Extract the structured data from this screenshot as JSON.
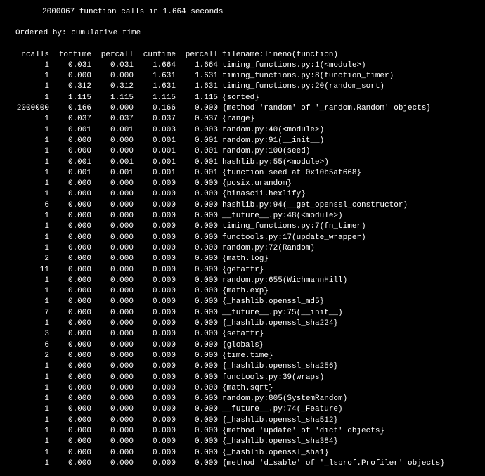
{
  "summary": "2000067 function calls in 1.664 seconds",
  "ordered_by": "Ordered by: cumulative time",
  "headers": {
    "ncalls": "ncalls",
    "tottime": "tottime",
    "percall": "percall",
    "cumtime": "cumtime",
    "percall2": "percall",
    "file": "filename:lineno(function)"
  },
  "rows": [
    {
      "ncalls": "1",
      "tottime": "0.031",
      "percall": "0.031",
      "cumtime": "1.664",
      "percall2": "1.664",
      "file": "timing_functions.py:1(<module>)"
    },
    {
      "ncalls": "1",
      "tottime": "0.000",
      "percall": "0.000",
      "cumtime": "1.631",
      "percall2": "1.631",
      "file": "timing_functions.py:8(function_timer)"
    },
    {
      "ncalls": "1",
      "tottime": "0.312",
      "percall": "0.312",
      "cumtime": "1.631",
      "percall2": "1.631",
      "file": "timing_functions.py:20(random_sort)"
    },
    {
      "ncalls": "1",
      "tottime": "1.115",
      "percall": "1.115",
      "cumtime": "1.115",
      "percall2": "1.115",
      "file": "{sorted}"
    },
    {
      "ncalls": "2000000",
      "tottime": "0.166",
      "percall": "0.000",
      "cumtime": "0.166",
      "percall2": "0.000",
      "file": "{method 'random' of '_random.Random' objects}"
    },
    {
      "ncalls": "1",
      "tottime": "0.037",
      "percall": "0.037",
      "cumtime": "0.037",
      "percall2": "0.037",
      "file": "{range}"
    },
    {
      "ncalls": "1",
      "tottime": "0.001",
      "percall": "0.001",
      "cumtime": "0.003",
      "percall2": "0.003",
      "file": "random.py:40(<module>)"
    },
    {
      "ncalls": "1",
      "tottime": "0.000",
      "percall": "0.000",
      "cumtime": "0.001",
      "percall2": "0.001",
      "file": "random.py:91(__init__)"
    },
    {
      "ncalls": "1",
      "tottime": "0.000",
      "percall": "0.000",
      "cumtime": "0.001",
      "percall2": "0.001",
      "file": "random.py:100(seed)"
    },
    {
      "ncalls": "1",
      "tottime": "0.001",
      "percall": "0.001",
      "cumtime": "0.001",
      "percall2": "0.001",
      "file": "hashlib.py:55(<module>)"
    },
    {
      "ncalls": "1",
      "tottime": "0.001",
      "percall": "0.001",
      "cumtime": "0.001",
      "percall2": "0.001",
      "file": "{function seed at 0x10b5af668}"
    },
    {
      "ncalls": "1",
      "tottime": "0.000",
      "percall": "0.000",
      "cumtime": "0.000",
      "percall2": "0.000",
      "file": "{posix.urandom}"
    },
    {
      "ncalls": "1",
      "tottime": "0.000",
      "percall": "0.000",
      "cumtime": "0.000",
      "percall2": "0.000",
      "file": "{binascii.hexlify}"
    },
    {
      "ncalls": "6",
      "tottime": "0.000",
      "percall": "0.000",
      "cumtime": "0.000",
      "percall2": "0.000",
      "file": "hashlib.py:94(__get_openssl_constructor)"
    },
    {
      "ncalls": "1",
      "tottime": "0.000",
      "percall": "0.000",
      "cumtime": "0.000",
      "percall2": "0.000",
      "file": "__future__.py:48(<module>)"
    },
    {
      "ncalls": "1",
      "tottime": "0.000",
      "percall": "0.000",
      "cumtime": "0.000",
      "percall2": "0.000",
      "file": "timing_functions.py:7(fn_timer)"
    },
    {
      "ncalls": "1",
      "tottime": "0.000",
      "percall": "0.000",
      "cumtime": "0.000",
      "percall2": "0.000",
      "file": "functools.py:17(update_wrapper)"
    },
    {
      "ncalls": "1",
      "tottime": "0.000",
      "percall": "0.000",
      "cumtime": "0.000",
      "percall2": "0.000",
      "file": "random.py:72(Random)"
    },
    {
      "ncalls": "2",
      "tottime": "0.000",
      "percall": "0.000",
      "cumtime": "0.000",
      "percall2": "0.000",
      "file": "{math.log}"
    },
    {
      "ncalls": "11",
      "tottime": "0.000",
      "percall": "0.000",
      "cumtime": "0.000",
      "percall2": "0.000",
      "file": "{getattr}"
    },
    {
      "ncalls": "1",
      "tottime": "0.000",
      "percall": "0.000",
      "cumtime": "0.000",
      "percall2": "0.000",
      "file": "random.py:655(WichmannHill)"
    },
    {
      "ncalls": "1",
      "tottime": "0.000",
      "percall": "0.000",
      "cumtime": "0.000",
      "percall2": "0.000",
      "file": "{math.exp}"
    },
    {
      "ncalls": "1",
      "tottime": "0.000",
      "percall": "0.000",
      "cumtime": "0.000",
      "percall2": "0.000",
      "file": "{_hashlib.openssl_md5}"
    },
    {
      "ncalls": "7",
      "tottime": "0.000",
      "percall": "0.000",
      "cumtime": "0.000",
      "percall2": "0.000",
      "file": "__future__.py:75(__init__)"
    },
    {
      "ncalls": "1",
      "tottime": "0.000",
      "percall": "0.000",
      "cumtime": "0.000",
      "percall2": "0.000",
      "file": "{_hashlib.openssl_sha224}"
    },
    {
      "ncalls": "3",
      "tottime": "0.000",
      "percall": "0.000",
      "cumtime": "0.000",
      "percall2": "0.000",
      "file": "{setattr}"
    },
    {
      "ncalls": "6",
      "tottime": "0.000",
      "percall": "0.000",
      "cumtime": "0.000",
      "percall2": "0.000",
      "file": "{globals}"
    },
    {
      "ncalls": "2",
      "tottime": "0.000",
      "percall": "0.000",
      "cumtime": "0.000",
      "percall2": "0.000",
      "file": "{time.time}"
    },
    {
      "ncalls": "1",
      "tottime": "0.000",
      "percall": "0.000",
      "cumtime": "0.000",
      "percall2": "0.000",
      "file": "{_hashlib.openssl_sha256}"
    },
    {
      "ncalls": "1",
      "tottime": "0.000",
      "percall": "0.000",
      "cumtime": "0.000",
      "percall2": "0.000",
      "file": "functools.py:39(wraps)"
    },
    {
      "ncalls": "1",
      "tottime": "0.000",
      "percall": "0.000",
      "cumtime": "0.000",
      "percall2": "0.000",
      "file": "{math.sqrt}"
    },
    {
      "ncalls": "1",
      "tottime": "0.000",
      "percall": "0.000",
      "cumtime": "0.000",
      "percall2": "0.000",
      "file": "random.py:805(SystemRandom)"
    },
    {
      "ncalls": "1",
      "tottime": "0.000",
      "percall": "0.000",
      "cumtime": "0.000",
      "percall2": "0.000",
      "file": "__future__.py:74(_Feature)"
    },
    {
      "ncalls": "1",
      "tottime": "0.000",
      "percall": "0.000",
      "cumtime": "0.000",
      "percall2": "0.000",
      "file": "{_hashlib.openssl_sha512}"
    },
    {
      "ncalls": "1",
      "tottime": "0.000",
      "percall": "0.000",
      "cumtime": "0.000",
      "percall2": "0.000",
      "file": "{method 'update' of 'dict' objects}"
    },
    {
      "ncalls": "1",
      "tottime": "0.000",
      "percall": "0.000",
      "cumtime": "0.000",
      "percall2": "0.000",
      "file": "{_hashlib.openssl_sha384}"
    },
    {
      "ncalls": "1",
      "tottime": "0.000",
      "percall": "0.000",
      "cumtime": "0.000",
      "percall2": "0.000",
      "file": "{_hashlib.openssl_sha1}"
    },
    {
      "ncalls": "1",
      "tottime": "0.000",
      "percall": "0.000",
      "cumtime": "0.000",
      "percall2": "0.000",
      "file": "{method 'disable' of '_lsprof.Profiler' objects}"
    }
  ]
}
